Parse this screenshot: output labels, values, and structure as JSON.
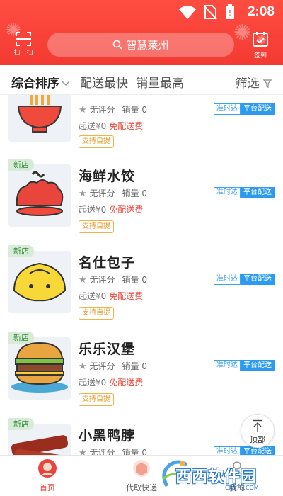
{
  "status_bar": {
    "time": "2:08"
  },
  "header": {
    "scan_label": "扫一扫",
    "search_text": "智慧莱州",
    "signin_label": "签到"
  },
  "sort_bar": {
    "items": [
      {
        "label": "综合排序",
        "active": true
      },
      {
        "label": "配送最快",
        "active": false
      },
      {
        "label": "销量最高",
        "active": false
      }
    ],
    "filter_label": "筛选"
  },
  "shops": [
    {
      "name": "",
      "is_new": false,
      "new_tag": "",
      "rating": "无评分",
      "sales": "销量 0",
      "min_order": "起送¥0",
      "free_delivery": "免配送费",
      "badge_ontime": "准时达",
      "badge_platform": "平台配送",
      "pickup": "支持自提",
      "icon": "noodle-bowl-icon"
    },
    {
      "name": "海鲜水饺",
      "is_new": true,
      "new_tag": "新店",
      "rating": "无评分",
      "sales": "销量 0",
      "min_order": "起送¥0",
      "free_delivery": "免配送费",
      "badge_ontime": "准时达",
      "badge_platform": "平台配送",
      "pickup": "支持自提",
      "icon": "dumpling-icon"
    },
    {
      "name": "名仕包子",
      "is_new": true,
      "new_tag": "新店",
      "rating": "无评分",
      "sales": "销量 0",
      "min_order": "起送¥0",
      "free_delivery": "免配送费",
      "badge_ontime": "准时达",
      "badge_platform": "平台配送",
      "pickup": "支持自提",
      "icon": "steamed-bun-icon"
    },
    {
      "name": "乐乐汉堡",
      "is_new": true,
      "new_tag": "新店",
      "rating": "无评分",
      "sales": "销量 0",
      "min_order": "起送¥0",
      "free_delivery": "免配送费",
      "badge_ontime": "准时达",
      "badge_platform": "平台配送",
      "pickup": "支持自提",
      "icon": "burger-icon"
    },
    {
      "name": "小黑鸭脖",
      "is_new": true,
      "new_tag": "新店",
      "rating": "无评分",
      "sales": "销量 0",
      "min_order": "",
      "free_delivery": "",
      "badge_ontime": "准时达",
      "badge_platform": "平台配送",
      "pickup": "",
      "icon": "duck-neck-icon"
    }
  ],
  "to_top_label": "顶部",
  "tab_bar": {
    "tabs": [
      {
        "label": "首页",
        "active": true,
        "icon": "home-avatar-icon"
      },
      {
        "label": "代取快递",
        "active": false,
        "icon": "express-icon"
      },
      {
        "label": "我的",
        "active": false,
        "icon": "profile-icon"
      }
    ]
  },
  "watermark": {
    "text": "西西软件园",
    "domain": "CR173.COM"
  },
  "colors": {
    "header_red": "#f33a32",
    "accent_red": "#e8463c",
    "platform_blue": "#2b9af0",
    "pickup_orange": "#e89a24",
    "new_green": "#2c8a36"
  }
}
